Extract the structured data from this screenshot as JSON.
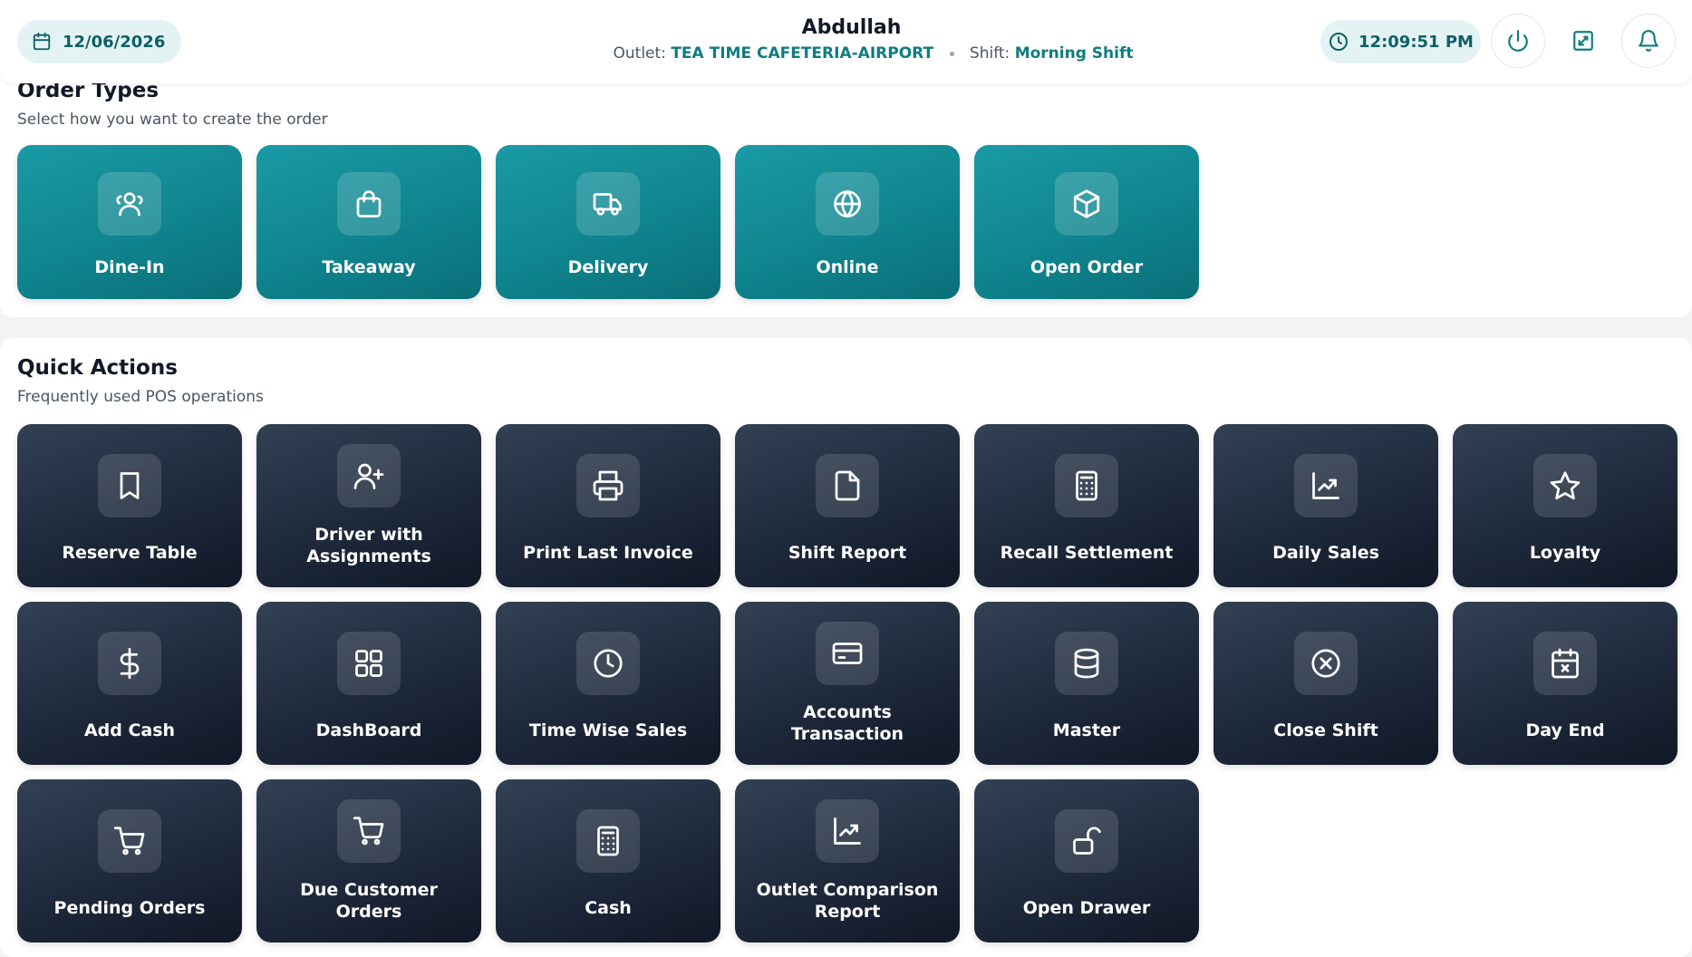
{
  "header": {
    "date": "12/06/2026",
    "user": "Abdullah",
    "outlet_label": "Outlet:",
    "outlet": "TEA TIME CAFETERIA-AIRPORT",
    "shift_label": "Shift:",
    "shift": "Morning Shift",
    "time": "12:09:51 PM"
  },
  "order_types": {
    "title": "Order Types",
    "subtitle": "Select how you want to create the order",
    "items": [
      {
        "label": "Dine-In",
        "icon": "users-icon"
      },
      {
        "label": "Takeaway",
        "icon": "shopping-bag-icon"
      },
      {
        "label": "Delivery",
        "icon": "truck-icon"
      },
      {
        "label": "Online",
        "icon": "globe-icon"
      },
      {
        "label": "Open Order",
        "icon": "box-icon"
      }
    ]
  },
  "quick_actions": {
    "title": "Quick Actions",
    "subtitle": "Frequently used POS operations",
    "items": [
      {
        "label": "Reserve Table",
        "icon": "bookmark-icon"
      },
      {
        "label": "Driver with Assignments",
        "icon": "user-plus-icon"
      },
      {
        "label": "Print Last Invoice",
        "icon": "printer-icon"
      },
      {
        "label": "Shift Report",
        "icon": "file-icon"
      },
      {
        "label": "Recall Settlement",
        "icon": "calculator-icon"
      },
      {
        "label": "Daily Sales",
        "icon": "chart-line-icon"
      },
      {
        "label": "Loyalty",
        "icon": "star-icon"
      },
      {
        "label": "Add Cash",
        "icon": "dollar-icon"
      },
      {
        "label": "DashBoard",
        "icon": "grid-icon"
      },
      {
        "label": "Time Wise Sales",
        "icon": "clock-icon"
      },
      {
        "label": "Accounts Transaction",
        "icon": "credit-card-icon"
      },
      {
        "label": "Master",
        "icon": "database-icon"
      },
      {
        "label": "Close Shift",
        "icon": "x-circle-icon"
      },
      {
        "label": "Day End",
        "icon": "calendar-x-icon"
      },
      {
        "label": "Pending Orders",
        "icon": "cart-icon"
      },
      {
        "label": "Due Customer Orders",
        "icon": "cart-icon"
      },
      {
        "label": "Cash",
        "icon": "calculator-icon"
      },
      {
        "label": "Outlet Comparison Report",
        "icon": "chart-line-icon"
      },
      {
        "label": "Open Drawer",
        "icon": "unlock-icon"
      }
    ]
  },
  "colors": {
    "accent": "#0f858f",
    "accent_text": "#0f7c80",
    "pill_bg": "#e3f3f3",
    "dark_tile": "#1e293b"
  }
}
